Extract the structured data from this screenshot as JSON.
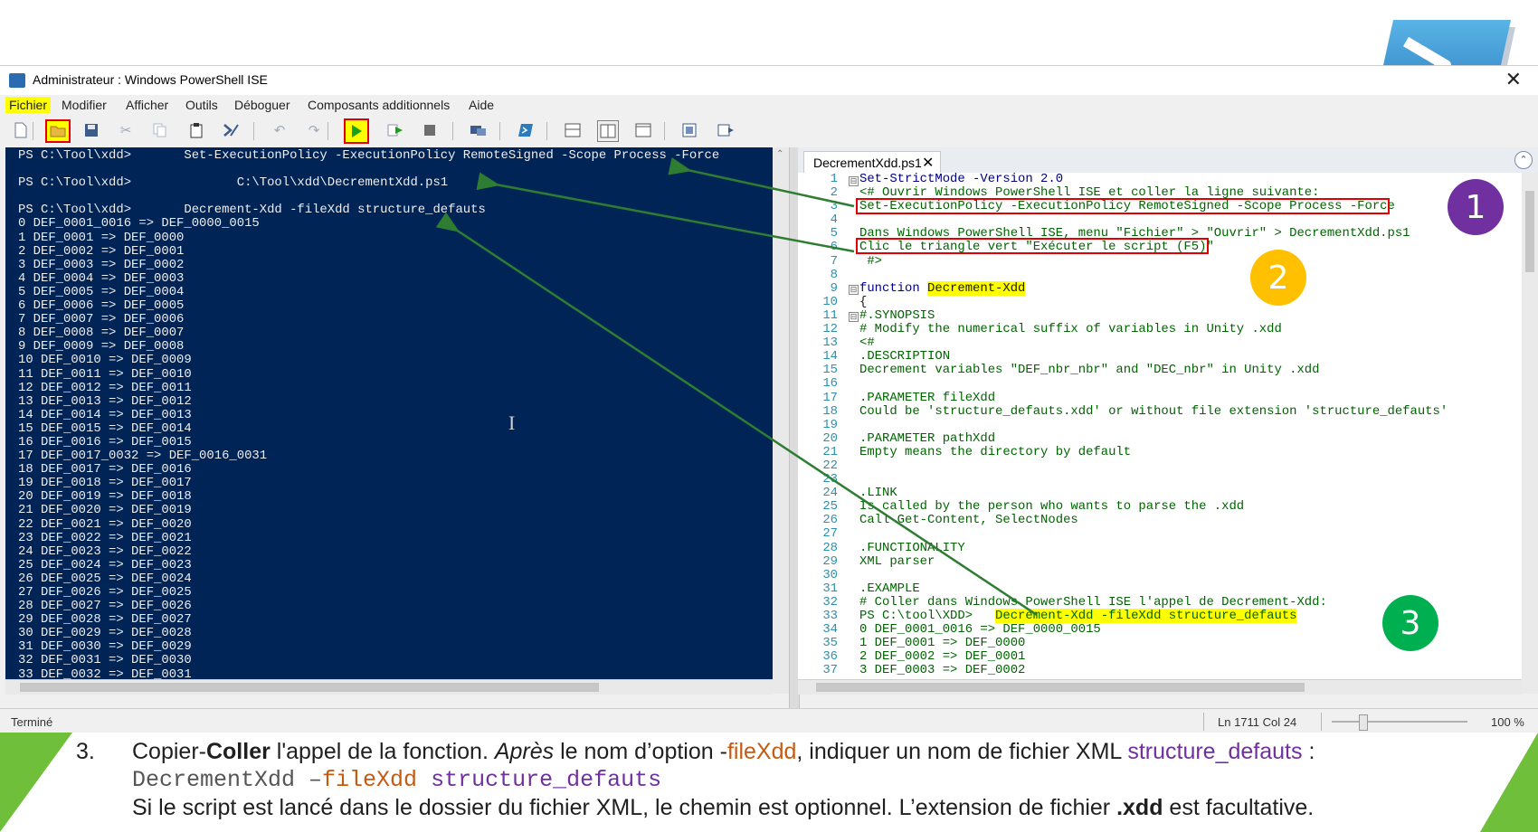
{
  "window": {
    "title": "Administrateur : Windows PowerShell ISE",
    "close_glyph": "✕"
  },
  "menu": [
    "Fichier",
    "Modifier",
    "Afficher",
    "Outils",
    "Déboguer",
    "Composants additionnels",
    "Aide"
  ],
  "toolbar_icons": [
    "new-file-icon",
    "open-file-icon",
    "save-icon",
    "cut-icon",
    "copy-icon",
    "paste-icon",
    "clear-console-icon",
    "undo-icon",
    "redo-icon",
    "run-script-icon",
    "run-selection-icon",
    "stop-icon",
    "remote-powershell-icon",
    "start-powershell-icon",
    "show-script-top-icon",
    "show-script-right-icon",
    "show-script-maximized-icon",
    "show-commands-icon",
    "show-addon-icon"
  ],
  "console": {
    "lines": [
      "PS C:\\Tool\\xdd>       Set-ExecutionPolicy -ExecutionPolicy RemoteSigned -Scope Process -Force",
      "",
      "PS C:\\Tool\\xdd>              C:\\Tool\\xdd\\DecrementXdd.ps1",
      "",
      "PS C:\\Tool\\xdd>       Decrement-Xdd -fileXdd structure_defauts",
      "0 DEF_0001_0016 => DEF_0000_0015",
      "1 DEF_0001 => DEF_0000",
      "2 DEF_0002 => DEF_0001",
      "3 DEF_0003 => DEF_0002",
      "4 DEF_0004 => DEF_0003",
      "5 DEF_0005 => DEF_0004",
      "6 DEF_0006 => DEF_0005",
      "7 DEF_0007 => DEF_0006",
      "8 DEF_0008 => DEF_0007",
      "9 DEF_0009 => DEF_0008",
      "10 DEF_0010 => DEF_0009",
      "11 DEF_0011 => DEF_0010",
      "12 DEF_0012 => DEF_0011",
      "13 DEF_0013 => DEF_0012",
      "14 DEF_0014 => DEF_0013",
      "15 DEF_0015 => DEF_0014",
      "16 DEF_0016 => DEF_0015",
      "17 DEF_0017_0032 => DEF_0016_0031",
      "18 DEF_0017 => DEF_0016",
      "19 DEF_0018 => DEF_0017",
      "20 DEF_0019 => DEF_0018",
      "21 DEF_0020 => DEF_0019",
      "22 DEF_0021 => DEF_0020",
      "23 DEF_0022 => DEF_0021",
      "24 DEF_0023 => DEF_0022",
      "25 DEF_0024 => DEF_0023",
      "26 DEF_0025 => DEF_0024",
      "27 DEF_0026 => DEF_0025",
      "28 DEF_0027 => DEF_0026",
      "29 DEF_0028 => DEF_0027",
      "30 DEF_0029 => DEF_0028",
      "31 DEF_0030 => DEF_0029",
      "32 DEF_0031 => DEF_0030",
      "33 DEF_0032 => DEF_0031"
    ]
  },
  "editor": {
    "tab_label": "DecrementXdd.ps1",
    "tab_close": "✕",
    "line_numbers": [
      "1",
      "2",
      "3",
      "4",
      "5",
      "6",
      "7",
      "8",
      "9",
      "10",
      "11",
      "12",
      "13",
      "14",
      "15",
      "16",
      "17",
      "18",
      "19",
      "20",
      "21",
      "22",
      "23",
      "24",
      "25",
      "26",
      "27",
      "28",
      "29",
      "30",
      "31",
      "32",
      "33",
      "34",
      "35",
      "36",
      "37"
    ],
    "lines": [
      "Set-StrictMode -Version 2.0",
      "<# Ouvrir Windows PowerShell ISE et coller la ligne suivante:",
      "Set-ExecutionPolicy -ExecutionPolicy RemoteSigned -Scope Process -Force",
      "",
      "Dans Windows PowerShell ISE, menu \"Fichier\" > \"Ouvrir\" > DecrementXdd.ps1",
      "Clic le triangle vert \"Exécuter le script (F5)\"",
      " #>",
      "",
      "function Decrement-Xdd",
      "{",
      "#.SYNOPSIS",
      "# Modify the numerical suffix of variables in Unity .xdd",
      "<#",
      ".DESCRIPTION",
      "Decrement variables \"DEF_nbr_nbr\" and \"DEC_nbr\" in Unity .xdd",
      "",
      ".PARAMETER fileXdd",
      "Could be 'structure_defauts.xdd' or without file extension 'structure_defauts'",
      "",
      ".PARAMETER pathXdd",
      "Empty means the directory by default",
      "",
      "",
      ".LINK",
      "Is called by the person who wants to parse the .xdd",
      "Call Get-Content, SelectNodes",
      "",
      ".FUNCTIONALITY",
      "XML parser",
      "",
      ".EXAMPLE",
      "# Coller dans Windows PowerShell ISE l'appel de Decrement-Xdd:",
      "PS C:\\tool\\XDD>   Decrement-Xdd -fileXdd structure_defauts",
      "0 DEF_0001_0016 => DEF_0000_0015",
      "1 DEF_0001 => DEF_0000",
      "2 DEF_0002 => DEF_0001",
      "3 DEF_0003 => DEF_0002"
    ]
  },
  "status": {
    "left": "Terminé",
    "position": "Ln 1711  Col 24",
    "zoom": "100 %"
  },
  "badges": [
    "1",
    "2",
    "3"
  ],
  "instruction": {
    "number": "3.",
    "line1_parts": [
      "Copier-",
      "Coller",
      " l'appel de la fonction. ",
      "Après",
      " le nom d’option -",
      "fileXdd",
      ", indiquer un nom de fichier XML ",
      "structure_defauts",
      " :"
    ],
    "line2_parts": [
      "DecrementXdd –",
      "fileXdd",
      " ",
      "structure_defauts"
    ],
    "line3_parts": [
      "Si le script est lancé dans le dossier du fichier XML, le chemin est optionnel. L’extension de fichier ",
      ".xdd",
      " est facultative."
    ]
  },
  "colors": {
    "console_bg": "#012456",
    "badge1": "#7030a0",
    "badge2": "#ffc000",
    "badge3": "#00b050",
    "accent_green": "#6fbf3b",
    "highlight": "#ffff00",
    "annotation_red": "#e00000",
    "arrow_green": "#2e7d32"
  }
}
